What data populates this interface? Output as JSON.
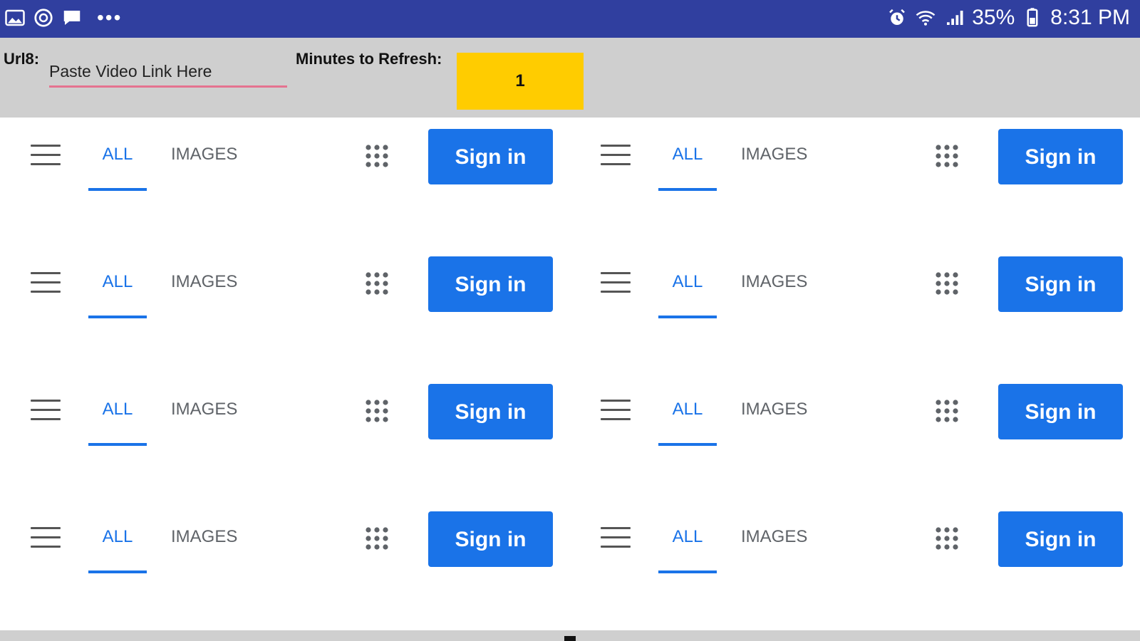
{
  "status_bar": {
    "left_icons": [
      "gallery-icon",
      "whatsapp-icon",
      "message-icon"
    ],
    "more": "•••",
    "battery": "35%",
    "time": "8:31 PM",
    "background": "#303f9f"
  },
  "controls": {
    "url_label": "Url8:",
    "url_placeholder": "Paste Video Link Here",
    "url_value": "",
    "refresh_label": "Minutes to Refresh:",
    "refresh_value": "1",
    "refresh_color": "#ffcc00"
  },
  "tiles": [
    {
      "tab_all": "ALL",
      "tab_images": "IMAGES",
      "sign_in": "Sign in"
    },
    {
      "tab_all": "ALL",
      "tab_images": "IMAGES",
      "sign_in": "Sign in"
    },
    {
      "tab_all": "ALL",
      "tab_images": "IMAGES",
      "sign_in": "Sign in"
    },
    {
      "tab_all": "ALL",
      "tab_images": "IMAGES",
      "sign_in": "Sign in"
    },
    {
      "tab_all": "ALL",
      "tab_images": "IMAGES",
      "sign_in": "Sign in"
    },
    {
      "tab_all": "ALL",
      "tab_images": "IMAGES",
      "sign_in": "Sign in"
    },
    {
      "tab_all": "ALL",
      "tab_images": "IMAGES",
      "sign_in": "Sign in"
    },
    {
      "tab_all": "ALL",
      "tab_images": "IMAGES",
      "sign_in": "Sign in"
    }
  ],
  "colors": {
    "accent": "#1a73e8",
    "tab_inactive": "#5f6368"
  }
}
